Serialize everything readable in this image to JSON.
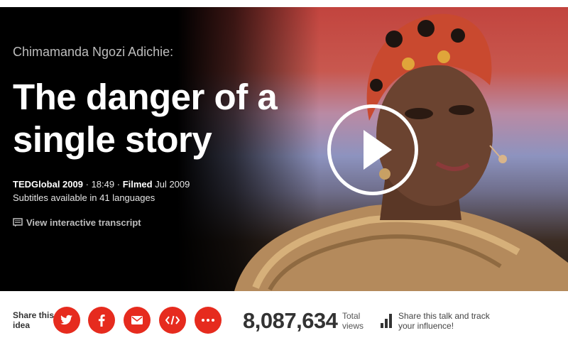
{
  "talk": {
    "speaker": "Chimamanda Ngozi Adichie:",
    "title": "The danger of a single story",
    "event": "TEDGlobal 2009",
    "duration": "18:49",
    "filmed_label": "Filmed",
    "filmed_date": "Jul 2009",
    "subtitles": "Subtitles available in 41 languages",
    "transcript_link": "View interactive transcript"
  },
  "player": {
    "play_icon": "play-icon"
  },
  "share": {
    "label": "Share this idea",
    "buttons": [
      {
        "name": "twitter-share-button",
        "icon": "twitter-icon"
      },
      {
        "name": "facebook-share-button",
        "icon": "facebook-icon"
      },
      {
        "name": "email-share-button",
        "icon": "email-icon"
      },
      {
        "name": "embed-share-button",
        "icon": "code-icon"
      },
      {
        "name": "more-share-button",
        "icon": "more-icon"
      }
    ],
    "views_count": "8,087,634",
    "views_label": "Total views",
    "influence_label": "Share this talk and track your influence!"
  },
  "colors": {
    "accent": "#e62b1e",
    "hero_background": "#000000",
    "title_text": "#ffffff",
    "speaker_text": "#bdbdbd"
  }
}
